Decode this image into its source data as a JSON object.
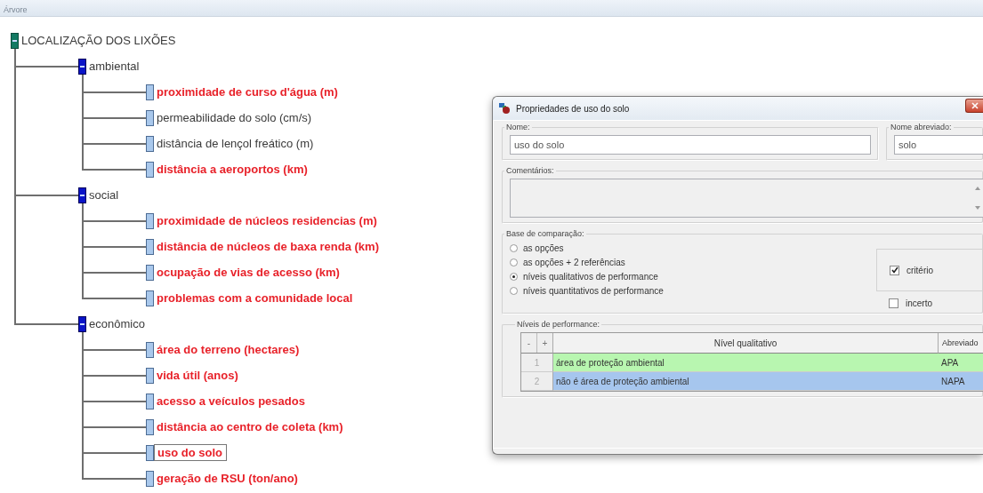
{
  "app": {
    "title": "Árvore"
  },
  "tree": {
    "label": "LOCALIZAÇÃO DOS LIXÕES",
    "kind": "root",
    "expanded": true,
    "emphasized": false,
    "selected": false,
    "children": [
      {
        "label": "ambiental",
        "kind": "group",
        "expanded": true,
        "emphasized": false,
        "selected": false,
        "children": [
          {
            "label": "proximidade de curso d'água (m)",
            "kind": "criterion",
            "emphasized": true,
            "selected": false
          },
          {
            "label": "permeabilidade do solo (cm/s)",
            "kind": "criterion",
            "emphasized": false,
            "selected": false
          },
          {
            "label": "distância de lençol freático (m)",
            "kind": "criterion",
            "emphasized": false,
            "selected": false
          },
          {
            "label": "distância a aeroportos (km)",
            "kind": "criterion",
            "emphasized": true,
            "selected": false
          }
        ]
      },
      {
        "label": "social",
        "kind": "group",
        "expanded": true,
        "emphasized": false,
        "selected": false,
        "children": [
          {
            "label": "proximidade de núcleos residencias (m)",
            "kind": "criterion",
            "emphasized": true,
            "selected": false
          },
          {
            "label": "distância de núcleos de baxa renda (km)",
            "kind": "criterion",
            "emphasized": true,
            "selected": false
          },
          {
            "label": "ocupação de vias de acesso (km)",
            "kind": "criterion",
            "emphasized": true,
            "selected": false
          },
          {
            "label": "problemas com a comunidade local",
            "kind": "criterion",
            "emphasized": true,
            "selected": false
          }
        ]
      },
      {
        "label": "econômico",
        "kind": "group",
        "expanded": true,
        "emphasized": false,
        "selected": false,
        "children": [
          {
            "label": "área do terreno (hectares)",
            "kind": "criterion",
            "emphasized": true,
            "selected": false
          },
          {
            "label": "vida útil (anos)",
            "kind": "criterion",
            "emphasized": true,
            "selected": false
          },
          {
            "label": "acesso a veículos pesados",
            "kind": "criterion",
            "emphasized": true,
            "selected": false
          },
          {
            "label": "distância ao centro de coleta (km)",
            "kind": "criterion",
            "emphasized": true,
            "selected": false
          },
          {
            "label": "uso do solo",
            "kind": "criterion",
            "emphasized": true,
            "selected": true
          },
          {
            "label": "geração de RSU (ton/ano)",
            "kind": "criterion",
            "emphasized": true,
            "selected": false
          }
        ]
      }
    ]
  },
  "dialog": {
    "title": "Propriedades de uso do solo",
    "name": {
      "label": "Nome:",
      "value": "uso do solo"
    },
    "short_name": {
      "label": "Nome abreviado:",
      "value": "solo"
    },
    "comments": {
      "label": "Comentários:"
    },
    "comparison": {
      "label": "Base de comparação:",
      "options": [
        {
          "label": "as opções",
          "selected": false
        },
        {
          "label": "as opções + 2 referências",
          "selected": false
        },
        {
          "label": "níveis qualitativos de performance",
          "selected": true
        },
        {
          "label": "níveis quantitativos de performance",
          "selected": false
        }
      ],
      "criterion": {
        "label": "critério",
        "checked": true
      },
      "uncertain": {
        "label": "incerto",
        "checked": false
      }
    },
    "levels": {
      "label": "Níveis de performance:",
      "remove": "-",
      "add": "+",
      "columns": [
        "Nível qualitativo",
        "Abreviado"
      ],
      "rows": [
        {
          "number": "1",
          "label": "área de proteção ambiental",
          "abbrev": "APA",
          "selected": false
        },
        {
          "number": "2",
          "label": "não é área de proteção ambiental",
          "abbrev": "NAPA",
          "selected": true
        }
      ]
    }
  }
}
